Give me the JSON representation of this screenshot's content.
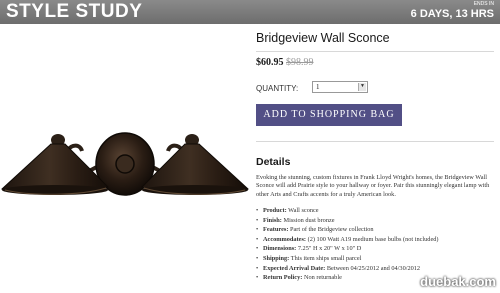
{
  "header": {
    "brand": "STYLE STUDY",
    "ends_label": "ENDS IN",
    "ends_value": "6 DAYS, 13 HRS"
  },
  "product": {
    "title": "Bridgeview Wall Sconce",
    "price": "$60.95",
    "original_price": "$98.99",
    "quantity_label": "QUANTITY:",
    "quantity_value": "1",
    "add_button_label": "ADD TO SHOPPING BAG",
    "image_icon": "wall-sconce-lamp-image"
  },
  "details": {
    "heading": "Details",
    "description": "Evoking the stunning, custom fixtures in Frank Lloyd Wright's homes, the Bridgeview Wall Sconce will add Prairie style to your hallway or foyer. Pair this stunningly elegant lamp with other Arts and Crafts accents for a truly American look.",
    "specs": [
      {
        "key": "Product:",
        "value": "Wall sconce"
      },
      {
        "key": "Finish:",
        "value": "Mission dust bronze"
      },
      {
        "key": "Features:",
        "value": "Part of the Bridgeview collection"
      },
      {
        "key": "Accommodates:",
        "value": "(2) 100 Watt A19 medium base bulbs (not included)"
      },
      {
        "key": "Dimensions:",
        "value": "7.25\" H x 20\" W x 10\" D"
      },
      {
        "key": "Shipping:",
        "value": "This item ships small parcel"
      },
      {
        "key": "Expected Arrival Date:",
        "value": "Between 04/25/2012 and 04/30/2012"
      },
      {
        "key": "Return Policy:",
        "value": "Non returnable"
      }
    ]
  },
  "watermark": "duebak.com",
  "colors": {
    "topbar": "#7a7a7a",
    "button": "#524f86",
    "lamp_body": "#2b2017"
  }
}
